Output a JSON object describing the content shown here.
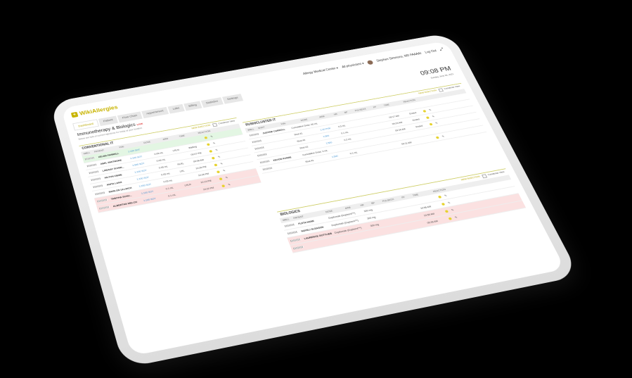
{
  "header": {
    "logo": "WikiAllergies",
    "location": "Allergy Medical Center ▾",
    "physicians": "All physicians ▾",
    "user": "Stephen Simmons, MD FAAAAI",
    "logout": "Log Out"
  },
  "nav": {
    "tabs": [
      "Dashboard",
      "Patient",
      "Flow Chart",
      "Appointment",
      "Labs",
      "Billing",
      "Statistics",
      "Settings"
    ]
  },
  "page": {
    "title": "Immunotherapy & Biologics",
    "live": "LIVE",
    "subtitle": "Below are lists of current injections for today at your location",
    "time": "09:08 PM",
    "date": "Sunday, June 06, 2021"
  },
  "conventional": {
    "title": "CONVENTIONAL IT",
    "new_injection": "NEW INJECTION",
    "condense": "Condense View",
    "columns": [
      "WBLL",
      "PATIENT",
      "VIAL",
      "DOSE",
      "ARM",
      "TIME",
      "REACTION"
    ],
    "rows": [
      {
        "name": "ZELMA FARRELL",
        "vial": "1:100 SOT",
        "dose": "",
        "arm": "",
        "time": "",
        "status": "green"
      },
      {
        "name": "ABEL WHITMORE",
        "vial": "1:100 SOT",
        "dose": "0.05 mL",
        "arm": "LRLN",
        "time": "Waiting",
        "status": ""
      },
      {
        "name": "LINDSAY SCHMI...",
        "vial": "1:500 SOT",
        "dose": "0.05 mL",
        "arm": "",
        "time": "09:07 PM",
        "status": ""
      },
      {
        "name": "HILTON ZIEME",
        "vial": "1:100 SOT",
        "dose": "0.05 mL",
        "arm": "RLRL",
        "time": "09:08 AM",
        "status": ""
      },
      {
        "name": "ANITA LANG",
        "vial": "1:100 SOT",
        "dose": "0.05 mL",
        "arm": "LRL",
        "time": "10:26 PM",
        "status": ""
      },
      {
        "name": "MARLON ULLRICH",
        "vial": "1:200 SOT",
        "dose": "0.05 mL",
        "arm": "",
        "time": "10:26 PM",
        "status": ""
      },
      {
        "name": "TABITHA SCHU...",
        "vial": "1:100 SOT",
        "dose": "0.1 mL",
        "arm": "LRLR",
        "time": "10:13 PM",
        "status": "pink"
      },
      {
        "name": "ALBERTHA WELCH",
        "vial": "1:100 SOT",
        "dose": "0.1 mL",
        "arm": "",
        "time": "10:22 PM",
        "status": "pink"
      }
    ]
  },
  "rush": {
    "title": "RUSH/CLUSTER IT",
    "new_injection": "NEW INJECTION",
    "condense": "Condense View",
    "columns": [
      "WBLL",
      "SHOT",
      "VIAL",
      "DOSE",
      "ARM",
      "HR",
      "BP",
      "PULSEOX",
      "PF",
      "TIME",
      "REACTION"
    ],
    "rows": [
      {
        "name": "JUSTINE CARROLL",
        "shot": "Cumulative Dose: 60 mL",
        "vial": "",
        "dose": "",
        "time": "",
        "extra": ""
      },
      {
        "name": "",
        "shot": "Shot #1",
        "vial": "1:10 PVR",
        "dose": "0.5 mL",
        "time": "09:17 AM",
        "extra": "Ended"
      },
      {
        "name": "",
        "shot": "Shot #2",
        "vial": "1:500",
        "dose": "0.1 mL",
        "time": "09:23 AM",
        "extra": "Ended"
      },
      {
        "name": "",
        "shot": "Shot #3",
        "vial": "1:500",
        "dose": "0.2 mL",
        "time": "09:34 AM",
        "extra": "Ended"
      },
      {
        "name": "KEVON KUNDE",
        "shot": "Cumulative Dose: 0 mL",
        "vial": "",
        "dose": "",
        "time": "",
        "extra": ""
      },
      {
        "name": "",
        "shot": "Shot #1",
        "vial": "1:500",
        "dose": "0.1 mL",
        "time": "09:11 AM",
        "extra": ""
      }
    ]
  },
  "biologics": {
    "title": "BIOLOGICS",
    "new_injection": "NEW INJECTION",
    "condense": "Condense View",
    "columns": [
      "WBLL",
      "PATIENT",
      "DOSE",
      "ARM",
      "HR",
      "BP",
      "PULSEOX",
      "PF",
      "TIME",
      "REACTION"
    ],
    "rows": [
      {
        "name": "FLETA HANE",
        "drug": "Dupilumab (Dupixent™)",
        "dose": "300 mg",
        "time": "",
        "status": ""
      },
      {
        "name": "NAYELI GLEASON",
        "drug": "Dupilumab (Dupixent™)",
        "dose": "300 mg",
        "time": "10:56 AM",
        "status": ""
      },
      {
        "name": "LAURENCE GOTTLIEB",
        "drug": "Dupilumab (Dupixent™)",
        "dose": "300 mg",
        "time": "10:56 AM",
        "status": "pink"
      },
      {
        "name": "",
        "drug": "",
        "dose": "",
        "time": "05:36 AM",
        "status": "pink"
      }
    ]
  }
}
